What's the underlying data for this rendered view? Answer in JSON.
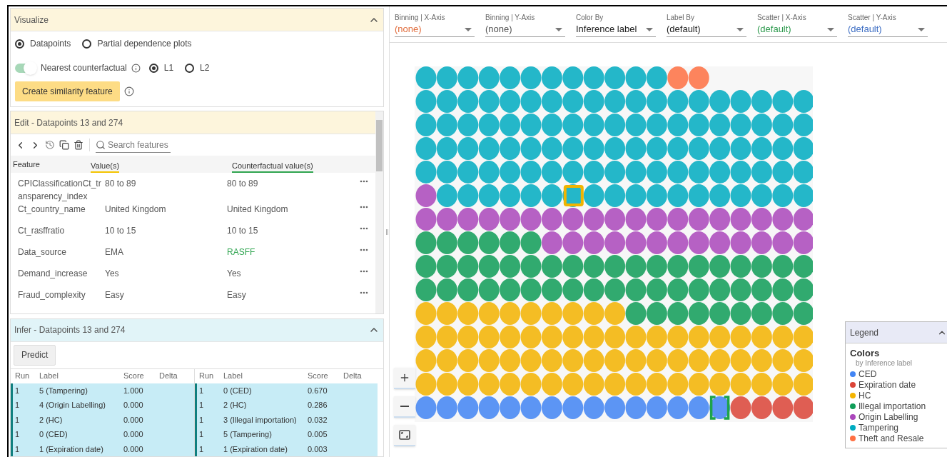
{
  "visualize": {
    "title": "Visualize",
    "expanded": true,
    "modes": [
      {
        "label": "Datapoints",
        "selected": true
      },
      {
        "label": "Partial dependence plots",
        "selected": false
      }
    ],
    "nearest_counterfactual": {
      "label": "Nearest counterfactual",
      "on": true
    },
    "distance": [
      {
        "label": "L1",
        "selected": true
      },
      {
        "label": "L2",
        "selected": false
      }
    ],
    "similarity_button": "Create similarity feature"
  },
  "edit": {
    "title": "Edit - Datapoints 13 and 274",
    "search": {
      "placeholder": "Search features"
    },
    "columns": [
      "Feature",
      "Value(s)",
      "Counterfactual value(s)"
    ],
    "rows": [
      {
        "feature": "CPIClassificationCt_transparency_index",
        "value": "80 to 89",
        "counterfactual": "80 to 89",
        "changed": false
      },
      {
        "feature": "Ct_country_name",
        "value": "United Kingdom",
        "counterfactual": "United Kingdom",
        "changed": false
      },
      {
        "feature": "Ct_rasffratio",
        "value": "10 to 15",
        "counterfactual": "10 to 15",
        "changed": false
      },
      {
        "feature": "Data_source",
        "value": "EMA",
        "counterfactual": "RASFF",
        "changed": true
      },
      {
        "feature": "Demand_increase",
        "value": "Yes",
        "counterfactual": "Yes",
        "changed": false
      },
      {
        "feature": "Fraud_complexity",
        "value": "Easy",
        "counterfactual": "Easy",
        "changed": false
      }
    ]
  },
  "infer": {
    "title": "Infer - Datapoints 13 and 274",
    "expanded": true,
    "predict_button": "Predict",
    "tables": [
      {
        "columns": [
          "Run",
          "Label",
          "Score",
          "Delta"
        ],
        "rows": [
          {
            "run": "1",
            "label": "5 (Tampering)",
            "score": "1.000"
          },
          {
            "run": "1",
            "label": "4 (Origin Labelling)",
            "score": "0.000"
          },
          {
            "run": "1",
            "label": "2 (HC)",
            "score": "0.000"
          },
          {
            "run": "1",
            "label": "0 (CED)",
            "score": "0.000"
          },
          {
            "run": "1",
            "label": "1 (Expiration date)",
            "score": "0.000"
          }
        ]
      },
      {
        "columns": [
          "Run",
          "Label",
          "Score",
          "Delta"
        ],
        "rows": [
          {
            "run": "1",
            "label": "0 (CED)",
            "score": "0.670"
          },
          {
            "run": "1",
            "label": "2 (HC)",
            "score": "0.286"
          },
          {
            "run": "1",
            "label": "3 (Illegal importation)",
            "score": "0.032"
          },
          {
            "run": "1",
            "label": "5 (Tampering)",
            "score": "0.005"
          },
          {
            "run": "1",
            "label": "1 (Expiration date)",
            "score": "0.003"
          }
        ]
      }
    ]
  },
  "dropdowns": [
    {
      "label": "Binning | X-Axis",
      "value": "(none)",
      "color": "#e06c3c"
    },
    {
      "label": "Binning | Y-Axis",
      "value": "(none)",
      "color": "#555555"
    },
    {
      "label": "Color By",
      "value": "Inference label",
      "color": "#222222"
    },
    {
      "label": "Label By",
      "value": "(default)",
      "color": "#222222"
    },
    {
      "label": "Scatter | X-Axis",
      "value": "(default)",
      "color": "#2e9a4e"
    },
    {
      "label": "Scatter | Y-Axis",
      "value": "(default)",
      "color": "#3f6fc4"
    }
  ],
  "legend": {
    "title": "Legend",
    "expanded": true,
    "heading": "Colors",
    "subtitle": "by Inference label",
    "items": [
      {
        "label": "CED",
        "color": "#4285f4"
      },
      {
        "label": "Expiration date",
        "color": "#db4437"
      },
      {
        "label": "HC",
        "color": "#f4b400"
      },
      {
        "label": "Illegal importation",
        "color": "#0f9d58"
      },
      {
        "label": "Origin Labelling",
        "color": "#ab47bc"
      },
      {
        "label": "Tampering",
        "color": "#00acc1"
      },
      {
        "label": "Theft and Resale",
        "color": "#ff7043"
      }
    ]
  }
}
